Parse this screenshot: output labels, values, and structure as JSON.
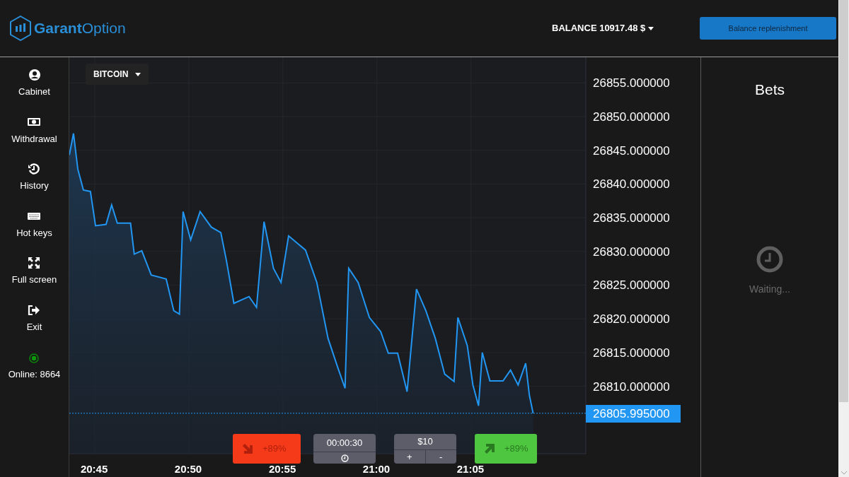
{
  "header": {
    "logo": "**Garant**Option",
    "balance": "BALANCE 10917.48 $",
    "replenish_button": "Balance replenishment"
  },
  "sidebar": {
    "items": [
      {
        "kind": "cabinet",
        "label": "Cabinet"
      },
      {
        "kind": "withdrawal",
        "label": "Withdrawal"
      },
      {
        "kind": "history",
        "label": "History"
      },
      {
        "kind": "hotkeys",
        "label": "Hot keys"
      },
      {
        "kind": "fullscreen",
        "label": "Full screen"
      },
      {
        "kind": "exit",
        "label": "Exit"
      }
    ],
    "online": "Online: 8664"
  },
  "chart": {
    "current_price": "26805.995000",
    "chart_data": {
      "type": "area",
      "grid": true,
      "ref_lines": [
        {
          "axis": "y",
          "value": 26805.995,
          "color": "#2196f3"
        }
      ],
      "xlim": [
        20.7275,
        21.185
      ],
      "ylim": [
        26800,
        26858.8
      ],
      "xticks": [
        {
          "value": 20.75,
          "label": "20:45"
        },
        {
          "value": 20.8333,
          "label": "20:50"
        },
        {
          "value": 20.9167,
          "label": "20:55"
        },
        {
          "value": 21.0,
          "label": "21:00"
        },
        {
          "value": 21.0833,
          "label": "21:05"
        }
      ],
      "yticks": [
        {
          "value": 26855,
          "label": "26855.000000"
        },
        {
          "value": 26850,
          "label": "26850.000000"
        },
        {
          "value": 26845,
          "label": "26845.000000"
        },
        {
          "value": 26840,
          "label": "26840.000000"
        },
        {
          "value": 26835,
          "label": "26835.000000"
        },
        {
          "value": 26830,
          "label": "26830.000000"
        },
        {
          "value": 26825,
          "label": "26825.000000"
        },
        {
          "value": 26820,
          "label": "26820.000000"
        },
        {
          "value": 26815,
          "label": "26815.000000"
        },
        {
          "value": 26810,
          "label": "26810.000000"
        }
      ],
      "x": [
        20.7275,
        20.7312,
        20.735,
        20.74,
        20.7462,
        20.7507,
        20.76,
        20.765,
        20.77,
        20.7817,
        20.785,
        20.7917,
        20.8,
        20.8133,
        20.82,
        20.825,
        20.8283,
        20.835,
        20.8433,
        20.8533,
        20.8617,
        20.8667,
        20.8733,
        20.8867,
        20.8933,
        20.9,
        20.9083,
        20.915,
        20.9217,
        20.9367,
        20.9467,
        20.9567,
        20.965,
        20.9717,
        20.975,
        20.9833,
        20.9933,
        21.0033,
        21.01,
        21.0183,
        21.0267,
        21.035,
        21.0433,
        21.0517,
        21.06,
        21.0683,
        21.0717,
        21.08,
        21.085,
        21.09,
        21.0933,
        21.1,
        21.1117,
        21.1183,
        21.125,
        21.1317,
        21.135,
        21.1383
      ],
      "series": [
        {
          "name": "BITCOIN",
          "color": "#2196f3",
          "values": [
            26844.3,
            26847.5,
            26842.2,
            26839.1,
            26838.9,
            26833.8,
            26834.0,
            26836.9,
            26834.2,
            26834.2,
            26829.6,
            26830.1,
            26826.5,
            26825.9,
            26821.2,
            26820.7,
            26835.9,
            26831.7,
            26835.9,
            26833.6,
            26832.8,
            26828.6,
            26822.3,
            26823.3,
            26821.7,
            26834.4,
            26827.5,
            26825.4,
            26832.3,
            26830.2,
            26825.4,
            26817.1,
            26812.9,
            26809.7,
            26827.5,
            26825.4,
            26820.2,
            26818.1,
            26814.9,
            26814.9,
            26809.2,
            26824.4,
            26821.2,
            26817.1,
            26811.8,
            26810.7,
            26820.2,
            26816.0,
            26810.2,
            26807.1,
            26815.0,
            26810.8,
            26810.8,
            26812.4,
            26810.2,
            26813.4,
            26808.7,
            26806.0
          ]
        }
      ]
    }
  },
  "trade": {
    "down_payout": "+89%",
    "timer": "00:00:30",
    "amount": "$10",
    "plus": "+",
    "minus": "-",
    "up_payout": "+89%"
  },
  "bets": {
    "title": "Bets",
    "status": "Waiting..."
  }
}
